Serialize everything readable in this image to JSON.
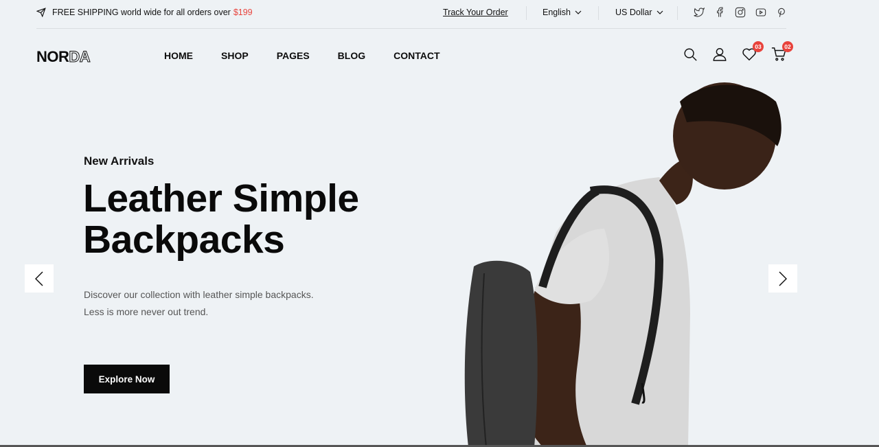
{
  "topbar": {
    "shipping_text": "FREE SHIPPING world wide for all orders over",
    "shipping_price": "$199",
    "track_order": "Track Your Order",
    "language": "English",
    "currency": "US Dollar",
    "social_icons": [
      "twitter-icon",
      "facebook-icon",
      "instagram-icon",
      "youtube-icon",
      "pinterest-icon"
    ]
  },
  "header": {
    "logo_solid": "NOR",
    "logo_outline": "DA",
    "nav": [
      "HOME",
      "SHOP",
      "PAGES",
      "BLOG",
      "CONTACT"
    ],
    "wishlist_count": "03",
    "cart_count": "02"
  },
  "hero": {
    "subtitle": "New Arrivals",
    "title_line1": "Leather Simple",
    "title_line2": "Backpacks",
    "desc_line1": "Discover our collection with leather simple backpacks.",
    "desc_line2": "Less is more never out trend.",
    "button": "Explore Now"
  },
  "colors": {
    "accent": "#e8433c",
    "background": "#eef2f5",
    "primary": "#0a0a0a"
  }
}
